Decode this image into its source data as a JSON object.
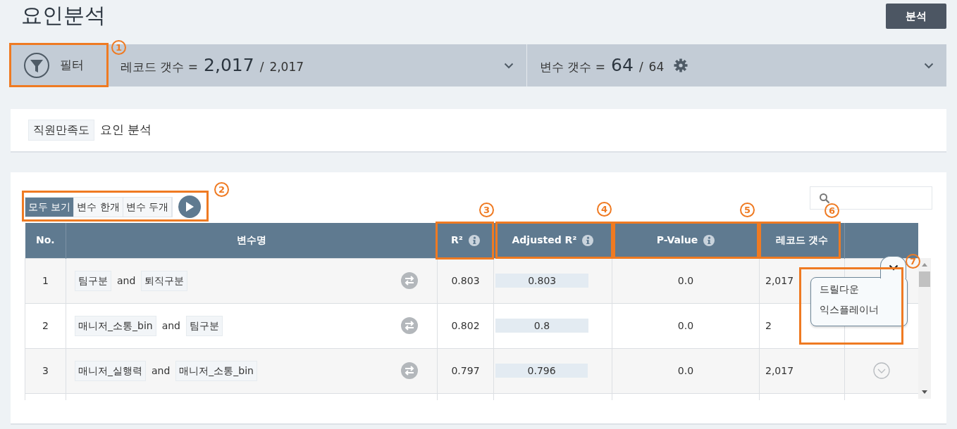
{
  "page_title": "요인분석",
  "analyze_button": "분석",
  "filter_bar": {
    "filter_label": "필터",
    "records": {
      "label": "레코드 갯수 =",
      "value": "2,017",
      "separator": "/",
      "total": "2,017"
    },
    "variables": {
      "label": "변수 갯수 =",
      "value": "64",
      "separator": "/",
      "total": "64"
    }
  },
  "breadcrumb": {
    "tag": "직원만족도",
    "text": "요인 분석"
  },
  "view_toggle": [
    {
      "label": "모두 보기",
      "selected": true
    },
    {
      "label": "변수 한개",
      "selected": false
    },
    {
      "label": "변수 두개",
      "selected": false
    }
  ],
  "table": {
    "columns": [
      {
        "label": "No.",
        "info": false
      },
      {
        "label": "변수명",
        "info": false
      },
      {
        "label": "R²",
        "info": true
      },
      {
        "label": "Adjusted R²",
        "info": true
      },
      {
        "label": "P-Value",
        "info": true
      },
      {
        "label": "레코드 갯수",
        "info": false
      }
    ],
    "rows": [
      {
        "no": "1",
        "name_parts": [
          {
            "kind": "tag",
            "text": "팀구분"
          },
          {
            "kind": "joiner",
            "text": "and"
          },
          {
            "kind": "tag",
            "text": "퇴직구분"
          }
        ],
        "r2": "0.803",
        "adj_r2": "0.803",
        "level": 0.803,
        "p_value": "0.0",
        "records": "2,017",
        "menu": {
          "expanded": true,
          "items": [
            "드릴다운",
            "익스플레이너"
          ]
        }
      },
      {
        "no": "2",
        "name_parts": [
          {
            "kind": "tag",
            "text": "매니저_소통_bin"
          },
          {
            "kind": "joiner",
            "text": "and"
          },
          {
            "kind": "tag",
            "text": "팀구분"
          }
        ],
        "r2": "0.802",
        "adj_r2": "0.8",
        "level": 0.8,
        "p_value": "0.0",
        "records": "2"
      },
      {
        "no": "3",
        "name_parts": [
          {
            "kind": "tag",
            "text": "매니저_실행력"
          },
          {
            "kind": "joiner",
            "text": "and"
          },
          {
            "kind": "tag",
            "text": "매니저_소통_bin"
          }
        ],
        "r2": "0.797",
        "adj_r2": "0.796",
        "level": 0.796,
        "p_value": "0.0",
        "records": "2,017",
        "menu": {
          "expanded": false
        }
      }
    ]
  },
  "callouts": [
    {
      "label": "1"
    },
    {
      "label": "2"
    },
    {
      "label": "3"
    },
    {
      "label": "4"
    },
    {
      "label": "5"
    },
    {
      "label": "6"
    },
    {
      "label": "7"
    }
  ]
}
